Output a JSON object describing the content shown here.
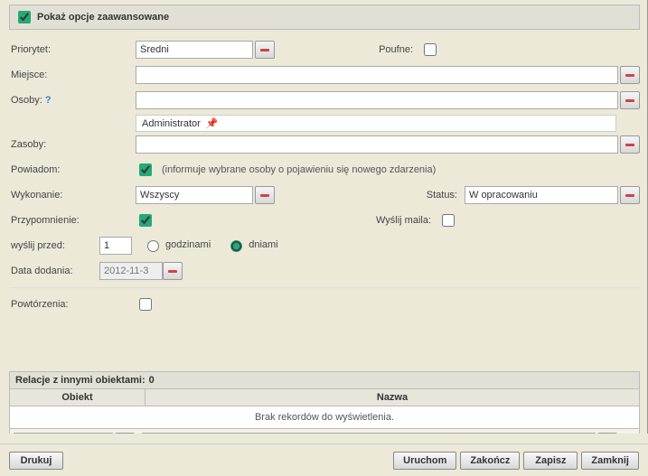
{
  "header": {
    "adv_options_label": "Pokaż opcje zaawansowane",
    "adv_checked": true
  },
  "fields": {
    "priority": {
      "label": "Priorytet:",
      "value": "Średni"
    },
    "confidential": {
      "label": "Poufne:",
      "checked": false
    },
    "place": {
      "label": "Miejsce:",
      "value": ""
    },
    "people": {
      "label": "Osoby:",
      "help": "?",
      "value": "",
      "tags": [
        "Administrator"
      ]
    },
    "resources": {
      "label": "Zasoby:",
      "value": ""
    },
    "notify": {
      "label": "Powiadom:",
      "checked": true,
      "info": "(informuje wybrane osoby o pojawieniu się nowego zdarzenia)"
    },
    "execution": {
      "label": "Wykonanie:",
      "value": "Wszyscy"
    },
    "status": {
      "label": "Status:",
      "value": "W opracowaniu"
    },
    "reminder": {
      "label": "Przypomnienie:",
      "checked": true
    },
    "send_mail": {
      "label": "Wyślij maila:",
      "checked": false
    },
    "send_before": {
      "label": "wyślij przed:",
      "value": "1",
      "opt_hours": "godzinami",
      "opt_days": "dniami",
      "selected": "days"
    },
    "date_added": {
      "label": "Data dodania:",
      "value": "2012-11-3"
    },
    "repetitions": {
      "label": "Powtórzenia:",
      "checked": false
    }
  },
  "relations": {
    "title": "Relacje z innymi obiektami:",
    "count": "0",
    "col_object": "Obiekt",
    "col_name": "Nazwa",
    "empty_msg": "Brak rekordów do wyświetlenia.",
    "filter_object": "",
    "filter_name": ""
  },
  "footer": {
    "print": "Drukuj",
    "run": "Uruchom",
    "finish": "Zakończ",
    "save": "Zapisz",
    "close": "Zamknij"
  }
}
